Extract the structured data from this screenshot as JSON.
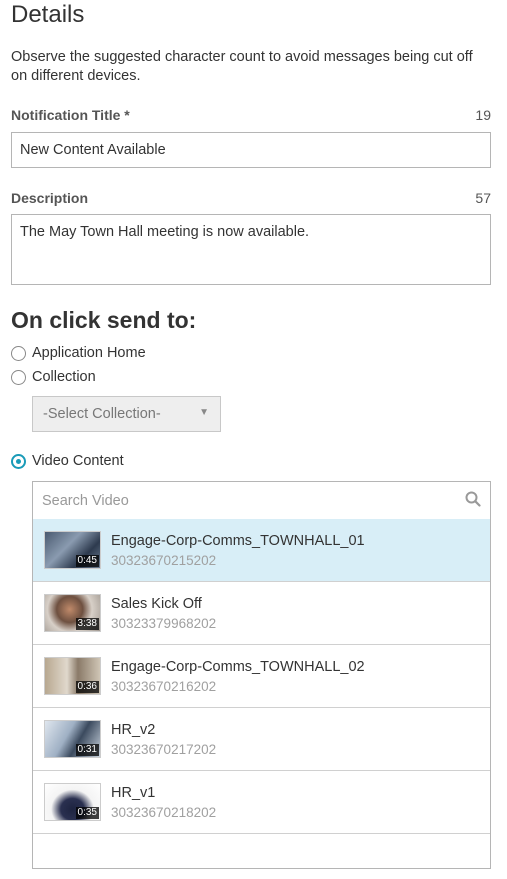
{
  "page": {
    "title": "Details",
    "help_text": "Observe the suggested character count to avoid messages being cut off on different devices."
  },
  "notification_title": {
    "label": "Notification Title *",
    "count": "19",
    "value": "New Content Available"
  },
  "description": {
    "label": "Description",
    "count": "57",
    "value": "The May Town Hall meeting is now available."
  },
  "on_click": {
    "title": "On click send to:",
    "options": [
      {
        "label": "Application Home",
        "checked": false
      },
      {
        "label": "Collection",
        "checked": false
      },
      {
        "label": "Video Content",
        "checked": true
      }
    ],
    "collection_select": {
      "value": "-Select Collection-"
    }
  },
  "video_search": {
    "placeholder": "Search Video",
    "icon": "search-icon"
  },
  "videos": [
    {
      "name": "Engage-Corp-Comms_TOWNHALL_01",
      "id": "30323670215202",
      "duration": "0:45",
      "selected": true
    },
    {
      "name": "Sales Kick Off",
      "id": "30323379968202",
      "duration": "3:38",
      "selected": false
    },
    {
      "name": "Engage-Corp-Comms_TOWNHALL_02",
      "id": "30323670216202",
      "duration": "0:36",
      "selected": false
    },
    {
      "name": "HR_v2",
      "id": "30323670217202",
      "duration": "0:31",
      "selected": false
    },
    {
      "name": "HR_v1",
      "id": "30323670218202",
      "duration": "0:35",
      "selected": false
    }
  ],
  "colors": {
    "accent": "#1a9bb8",
    "selected_row": "#d8eef7",
    "id_text": "#a0a0a0"
  }
}
